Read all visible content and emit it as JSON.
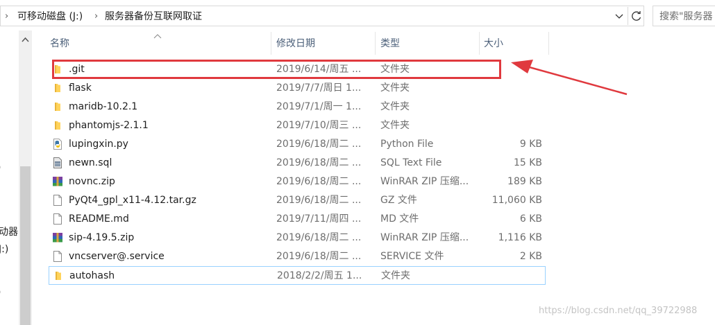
{
  "address_bar": {
    "nav_arrow": "›",
    "crumbs": [
      "可移动磁盘 (J:)",
      "服务器备份互联网取证"
    ],
    "separator": "›"
  },
  "search": {
    "placeholder": "搜索\"服务器"
  },
  "nav_pane": {
    "fragments": [
      ")",
      "动器",
      "J:)",
      ")"
    ]
  },
  "columns": {
    "name": "名称",
    "modified": "修改日期",
    "type": "类型",
    "size": "大小"
  },
  "files": [
    {
      "name": ".git",
      "modified": "2019/6/14/周五 ...",
      "type": "文件夹",
      "size": "",
      "icon": "folder-icon"
    },
    {
      "name": "flask",
      "modified": "2019/7/7/周日 1...",
      "type": "文件夹",
      "size": "",
      "icon": "folder-icon"
    },
    {
      "name": "maridb-10.2.1",
      "modified": "2019/7/1/周一 1...",
      "type": "文件夹",
      "size": "",
      "icon": "folder-icon"
    },
    {
      "name": "phantomjs-2.1.1",
      "modified": "2019/7/10/周三 ...",
      "type": "文件夹",
      "size": "",
      "icon": "folder-icon"
    },
    {
      "name": "lupingxin.py",
      "modified": "2019/6/18/周二 ...",
      "type": "Python File",
      "size": "9 KB",
      "icon": "python-file-icon"
    },
    {
      "name": "newn.sql",
      "modified": "2019/6/18/周二 ...",
      "type": "SQL Text File",
      "size": "15 KB",
      "icon": "sql-file-icon"
    },
    {
      "name": "novnc.zip",
      "modified": "2019/6/18/周二 ...",
      "type": "WinRAR ZIP 压缩...",
      "size": "189 KB",
      "icon": "winrar-zip-icon"
    },
    {
      "name": "PyQt4_gpl_x11-4.12.tar.gz",
      "modified": "2019/6/18/周二 ...",
      "type": "GZ 文件",
      "size": "11,060 KB",
      "icon": "generic-file-icon"
    },
    {
      "name": "README.md",
      "modified": "2019/7/11/周四 ...",
      "type": "MD 文件",
      "size": "6 KB",
      "icon": "generic-file-icon"
    },
    {
      "name": "sip-4.19.5.zip",
      "modified": "2019/6/18/周二 ...",
      "type": "WinRAR ZIP 压缩...",
      "size": "1,116 KB",
      "icon": "winrar-zip-icon"
    },
    {
      "name": "vncserver@.service",
      "modified": "2019/6/18/周二 ...",
      "type": "SERVICE 文件",
      "size": "2 KB",
      "icon": "generic-file-icon"
    },
    {
      "name": "autohash",
      "modified": "2018/2/2/周五 1...",
      "type": "文件夹",
      "size": "",
      "icon": "folder-icon"
    }
  ],
  "selected_row": "autohash",
  "highlighted_row": ".git",
  "watermark": "https://blog.csdn.net/qq_39722988",
  "colors": {
    "annotation": "#e0393e",
    "selection_border": "#99d1ff",
    "folder": "#ffd35b"
  }
}
